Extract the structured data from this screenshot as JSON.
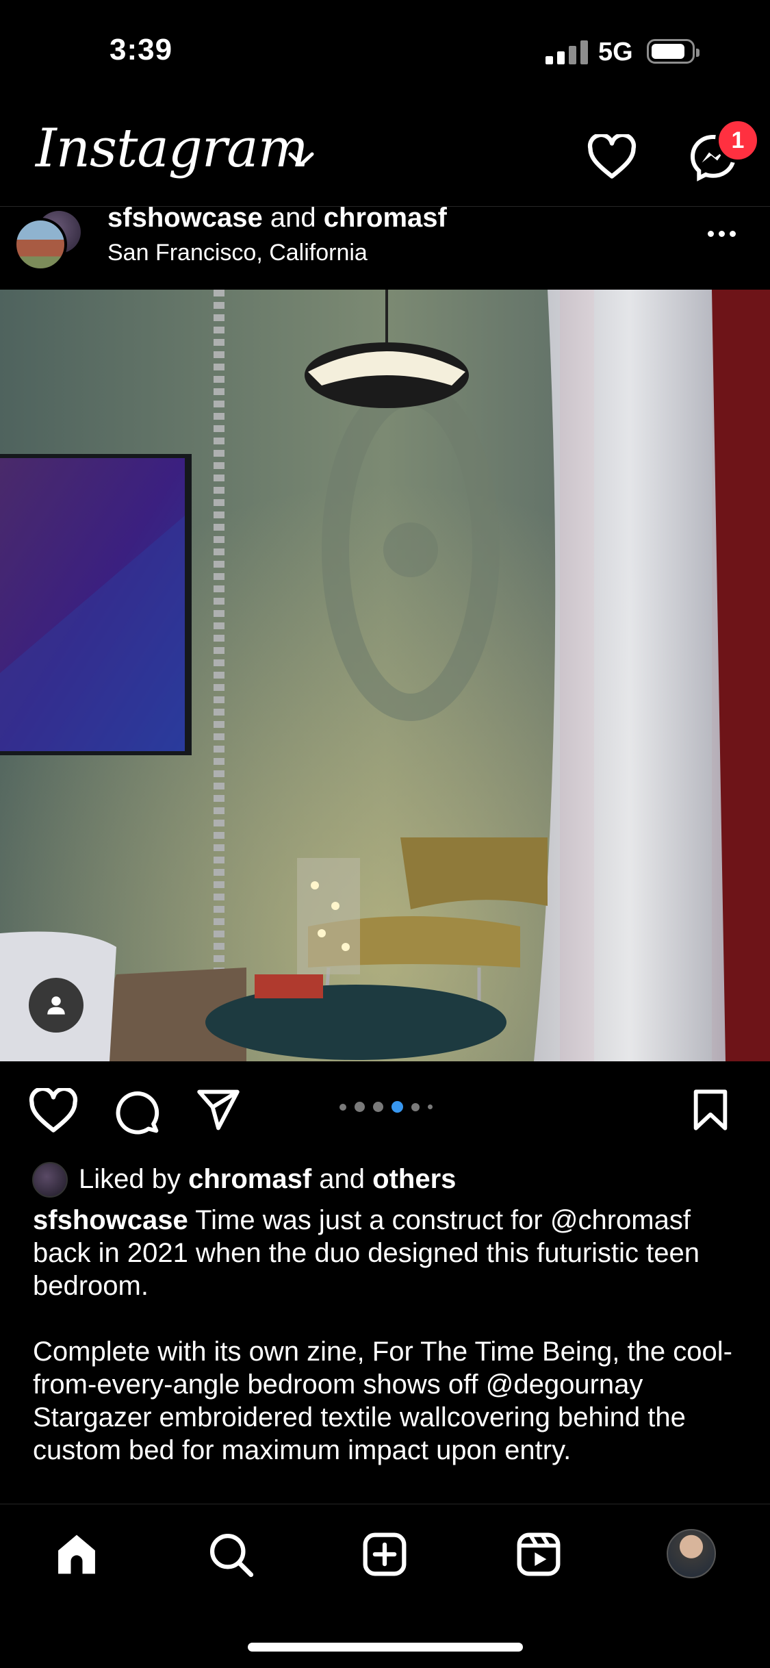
{
  "status_bar": {
    "time": "3:39",
    "network": "5G"
  },
  "header": {
    "app_name": "Instagram",
    "messages_badge": "1"
  },
  "post": {
    "user_1": "sfshowcase",
    "connector": "and",
    "user_2": "chromasf",
    "location": "San Francisco, California",
    "carousel": {
      "count": 6,
      "active_index": 3
    },
    "liked_by": {
      "prefix": "Liked by",
      "user": "chromasf",
      "connector": "and",
      "others": "others"
    },
    "caption": {
      "author": "sfshowcase",
      "text_1": "Time was just a construct for @chromasf back in 2021 when the duo designed this futuristic teen bedroom.",
      "text_2": "Complete with its own zine, For The Time Being, the cool-from-every-angle bedroom shows off @degournay Stargazer embroidered textile wallcovering behind the custom bed for maximum impact upon entry."
    }
  },
  "nav": {
    "icons": [
      "home-icon",
      "search-icon",
      "create-icon",
      "reels-icon",
      "profile-avatar"
    ]
  },
  "colors": {
    "badge": "#ff3040",
    "active_dot": "#3897f0"
  }
}
